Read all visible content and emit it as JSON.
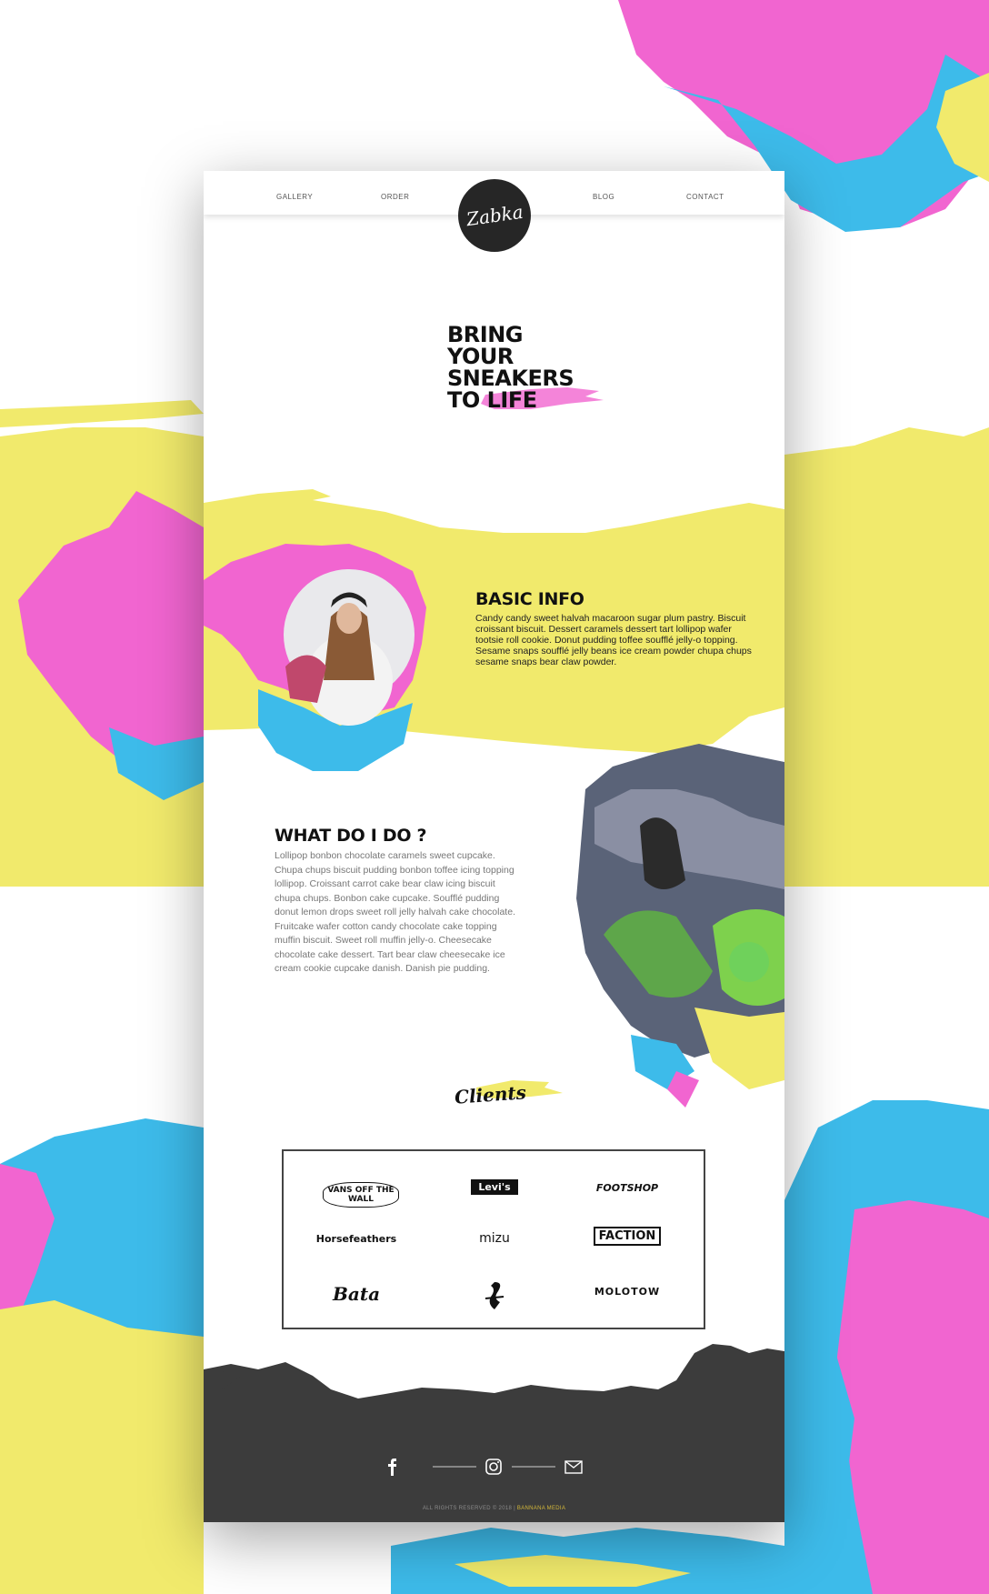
{
  "nav": {
    "items": [
      "GALLERY",
      "ORDER",
      "BLOG",
      "CONTACT"
    ],
    "logo_text": "Zabka"
  },
  "hero": {
    "lines": [
      "BRING",
      "YOUR",
      "SNEAKERS",
      "TO LIFE"
    ]
  },
  "basic_info": {
    "title": "BASIC INFO",
    "text": "Candy candy sweet halvah macaroon sugar plum pastry. Biscuit croissant biscuit. Dessert caramels dessert tart lollipop wafer tootsie roll cookie. Donut pudding toffee soufflé jelly-o topping. Sesame snaps soufflé jelly beans ice cream powder chupa chups sesame snaps bear claw powder."
  },
  "what_i_do": {
    "title": "WHAT DO I DO ?",
    "text": "Lollipop bonbon chocolate caramels sweet cupcake. Chupa chups biscuit pudding bonbon toffee icing topping lollipop. Croissant carrot cake bear claw icing biscuit chupa chups. Bonbon cake cupcake. Soufflé pudding donut lemon drops sweet roll jelly halvah cake chocolate. Fruitcake wafer cotton candy chocolate cake topping muffin biscuit. Sweet roll muffin jelly-o. Cheesecake chocolate cake dessert. Tart bear claw cheesecake ice cream cookie cupcake danish. Danish pie pudding."
  },
  "clients": {
    "title": "Clients",
    "logos": [
      "VANS OFF THE WALL",
      "Levi's",
      "FOOTSHOP",
      "Horsefeathers",
      "mizu",
      "FACTION",
      "Bata",
      "",
      "MOLOTOW"
    ]
  },
  "footer": {
    "social_icons": [
      "facebook-icon",
      "instagram-icon",
      "mail-icon"
    ],
    "copyright": "ALL RIGHTS RESERVED © 2018 |",
    "credit": "BANNANA MEDIA"
  },
  "colors": {
    "pink": "#F165D0",
    "blue": "#3DBBEA",
    "yellow": "#F1EA6C",
    "dark": "#3C3C3C"
  }
}
